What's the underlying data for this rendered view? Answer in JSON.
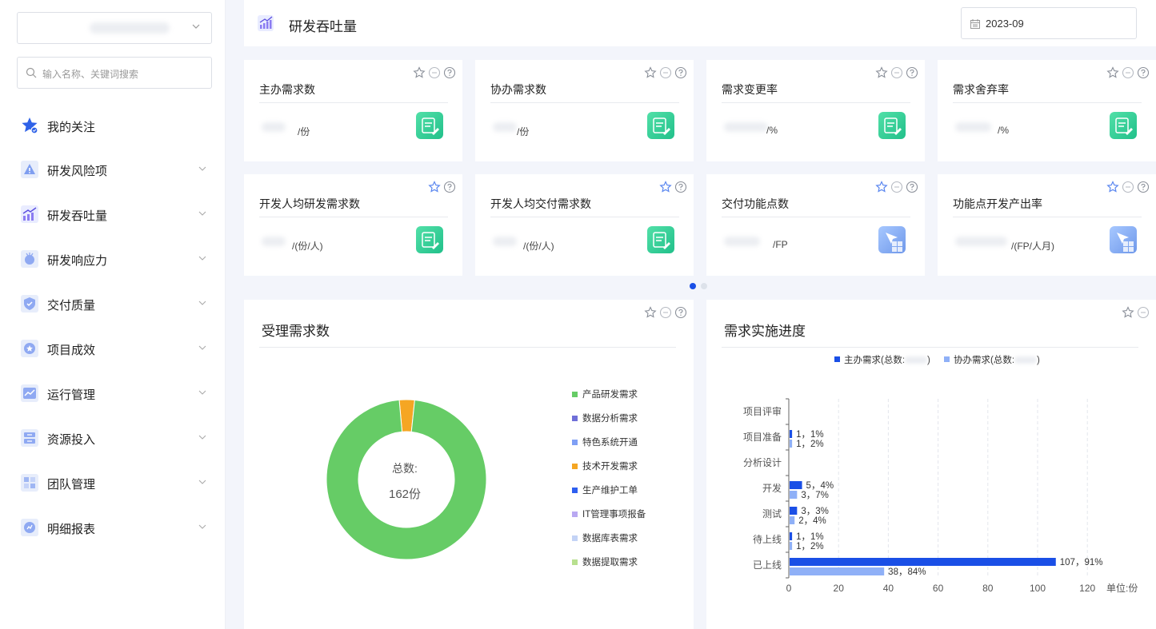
{
  "sidebar": {
    "search_placeholder": "输入名称、关键词搜索",
    "items": [
      {
        "label": "我的关注",
        "icon": "star-icon"
      },
      {
        "label": "研发风险项",
        "icon": "warning-icon"
      },
      {
        "label": "研发吞吐量",
        "icon": "throughput-chart-icon"
      },
      {
        "label": "研发响应力",
        "icon": "response-icon"
      },
      {
        "label": "交付质量",
        "icon": "shield-check-icon"
      },
      {
        "label": "项目成效",
        "icon": "badge-star-icon"
      },
      {
        "label": "运行管理",
        "icon": "trend-icon"
      },
      {
        "label": "资源投入",
        "icon": "server-icon"
      },
      {
        "label": "团队管理",
        "icon": "grid-icon"
      },
      {
        "label": "明细报表",
        "icon": "report-icon"
      }
    ]
  },
  "header": {
    "title": "研发吞吐量",
    "date_value": "2023-09"
  },
  "kpis": [
    {
      "title": "主办需求数",
      "unit": "/份"
    },
    {
      "title": "协办需求数",
      "unit": "/份"
    },
    {
      "title": "需求变更率",
      "unit": "/%"
    },
    {
      "title": "需求舍弃率",
      "unit": "/%"
    },
    {
      "title": "开发人均研发需求数",
      "unit": "/(份/人)"
    },
    {
      "title": "开发人均交付需求数",
      "unit": "/(份/人)"
    },
    {
      "title": "交付功能点数",
      "unit": "/FP"
    },
    {
      "title": "功能点开发产出率",
      "unit": "/(FP/人月)"
    }
  ],
  "donut_panel": {
    "title": "受理需求数",
    "center_label": "总数:",
    "center_value": "162份"
  },
  "bar_panel": {
    "title": "需求实施进度",
    "legend_primary": "主办需求(总数:",
    "legend_secondary": "协办需求(总数:",
    "legend_close": ")",
    "unit_label": "单位:份"
  },
  "colors": {
    "primary_blue": "#1a4fe6",
    "light_blue": "#8fb0f7",
    "donut_green": "#66cc66",
    "donut_orange": "#f5a623",
    "kpi_badge_green": "#2fcf8f",
    "kpi_badge_blue": "#7fa8f0"
  },
  "chart_data": [
    {
      "type": "pie",
      "title": "受理需求数",
      "categories": [
        "产品研发需求",
        "数据分析需求",
        "特色系统开通",
        "技术开发需求",
        "生产维护工单",
        "IT管理事项报备",
        "数据库表需求",
        "数据提取需求"
      ],
      "values": [
        157,
        0,
        0,
        5,
        0,
        0,
        0,
        0
      ],
      "colors": [
        "#66cc66",
        "#6f6fd8",
        "#7f9ff5",
        "#f5a623",
        "#2e5ff0",
        "#b9a8f2",
        "#c3d3f6",
        "#b8e08f"
      ],
      "legend_position": "right"
    },
    {
      "type": "bar",
      "title": "需求实施进度",
      "orientation": "horizontal",
      "categories": [
        "项目评审",
        "项目准备",
        "分析设计",
        "开发",
        "测试",
        "待上线",
        "已上线"
      ],
      "series": [
        {
          "name": "主办需求",
          "values": [
            0,
            1,
            0,
            5,
            3,
            1,
            107
          ],
          "labels": [
            "",
            "1，1%",
            "",
            "5，4%",
            "3，3%",
            "1，1%",
            "107，91%"
          ]
        },
        {
          "name": "协办需求",
          "values": [
            0,
            1,
            0,
            3,
            2,
            1,
            38
          ],
          "labels": [
            "",
            "1，2%",
            "",
            "3，7%",
            "2，4%",
            "1，2%",
            "38，84%"
          ]
        }
      ],
      "xlim": [
        0,
        140
      ],
      "xticks": [
        "0",
        "20",
        "40",
        "60",
        "80",
        "100",
        "120"
      ],
      "xunit": "单位:份",
      "legend_position": "top"
    }
  ]
}
